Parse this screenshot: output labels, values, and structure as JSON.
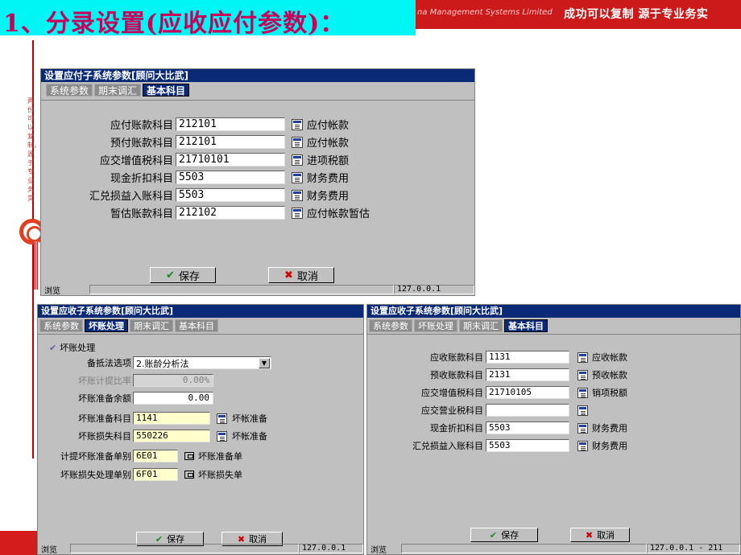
{
  "header": {
    "title": "1、分录设置(应收应付参数)：",
    "banner_company": "na Management Systems Limited",
    "banner_slogan": "成功可以复制  源于专业务实"
  },
  "left_vertical_text": "两份可以复制，源于专业务实",
  "ap_dialog": {
    "title": "设置应付子系统参数[顾问大比武]",
    "tabs": [
      "系统参数",
      "期末调汇",
      "基本科目"
    ],
    "active_tab": "基本科目",
    "fields": [
      {
        "label": "应付账款科目",
        "value": "212101",
        "account_name": "应付帐款"
      },
      {
        "label": "预付账款科目",
        "value": "212101",
        "account_name": "应付帐款"
      },
      {
        "label": "应交增值税科目",
        "value": "21710101",
        "account_name": "进项税额"
      },
      {
        "label": "现金折扣科目",
        "value": "5503",
        "account_name": "财务费用"
      },
      {
        "label": "汇兑损益入账科目",
        "value": "5503",
        "account_name": "财务费用"
      },
      {
        "label": "暂估账款科目",
        "value": "212102",
        "account_name": "应付帐款暂估"
      }
    ],
    "save_label": "保存",
    "cancel_label": "取消",
    "status_left": "浏览",
    "status_right": "127.0.0.1"
  },
  "ar_bad_debt_dialog": {
    "title": "设置应收子系统参数[顾问大比武]",
    "tabs": [
      "系统参数",
      "坏账处理",
      "期末调汇",
      "基本科目"
    ],
    "active_tab": "坏账处理",
    "bad_debt_checkbox_label": "坏账处理",
    "method_label": "备抵法选项",
    "method_value": "2.账龄分析法",
    "rate_label": "坏账计提比率",
    "rate_value": "0.00%",
    "balance_label": "坏账准备余额",
    "balance_value": "0.00",
    "reserve_account_label": "坏账准备科目",
    "reserve_account_value": "1141",
    "reserve_account_name": "坏帐准备",
    "loss_account_label": "坏账损失科目",
    "loss_account_value": "550226",
    "loss_account_name": "坏帐准备",
    "reserve_doc_label": "计提坏账准备单别",
    "reserve_doc_value": "6E01",
    "reserve_doc_name": "坏账准备单",
    "loss_doc_label": "坏账损失处理单别",
    "loss_doc_value": "6F01",
    "loss_doc_name": "坏账损失单",
    "save_label": "保存",
    "cancel_label": "取消",
    "status_left": "浏览",
    "status_right": "127.0.0.1"
  },
  "ar_accounts_dialog": {
    "title": "设置应收子系统参数[顾问大比武]",
    "tabs": [
      "系统参数",
      "坏账处理",
      "期末调汇",
      "基本科目"
    ],
    "active_tab": "基本科目",
    "fields": [
      {
        "label": "应收账款科目",
        "value": "1131",
        "account_name": "应收帐款"
      },
      {
        "label": "预收账款科目",
        "value": "2131",
        "account_name": "预收帐款"
      },
      {
        "label": "应交增值税科目",
        "value": "21710105",
        "account_name": "销项税额"
      },
      {
        "label": "应交营业税科目",
        "value": "",
        "account_name": ""
      },
      {
        "label": "现金折扣科目",
        "value": "5503",
        "account_name": "财务费用"
      },
      {
        "label": "汇兑损益入账科目",
        "value": "5503",
        "account_name": "财务费用"
      }
    ],
    "save_label": "保存",
    "cancel_label": "取消",
    "status_left": "浏览",
    "status_right": "127.0.0.1 - 211"
  },
  "colors": {
    "title_bg": "#00f5f5",
    "title_text": "#c8005a",
    "banner_bg": "#cc1a1a",
    "dialog_bg": "#c0c0c0",
    "active_tab": "#0a2a78",
    "yellow_input": "#ffffcc"
  }
}
